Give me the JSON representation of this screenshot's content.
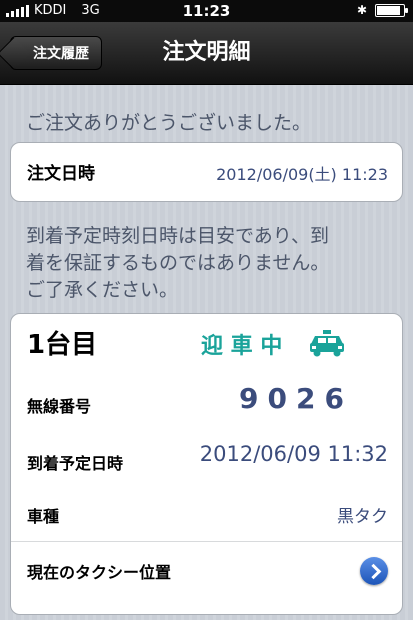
{
  "status_bar": {
    "carrier": "KDDI",
    "network": "3G",
    "time": "11:23",
    "battery_level": 0.9
  },
  "nav": {
    "back_label": "注文履歴",
    "title": "注文明細"
  },
  "thanks_message": "ご注文ありがとうございました。",
  "order": {
    "label": "注文日時",
    "value": "2012/06/09(土) 11:23"
  },
  "notice": [
    "到着予定時刻日時は目安であり、到",
    "着を保証するものではありません。",
    "ご了承ください。"
  ],
  "vehicle": {
    "title": "1台目",
    "status": "迎 車 中",
    "radio_label": "無線番号",
    "radio_number": "9026",
    "eta_label": "到着予定日時",
    "eta_value": "2012/06/09 11:32",
    "type_label": "車種",
    "type_value": "黒タク",
    "location_label": "現在のタクシー位置"
  },
  "colors": {
    "status_teal": "#1aa39a",
    "value_blue": "#3b4c7c",
    "message_gray": "#4c566a"
  }
}
